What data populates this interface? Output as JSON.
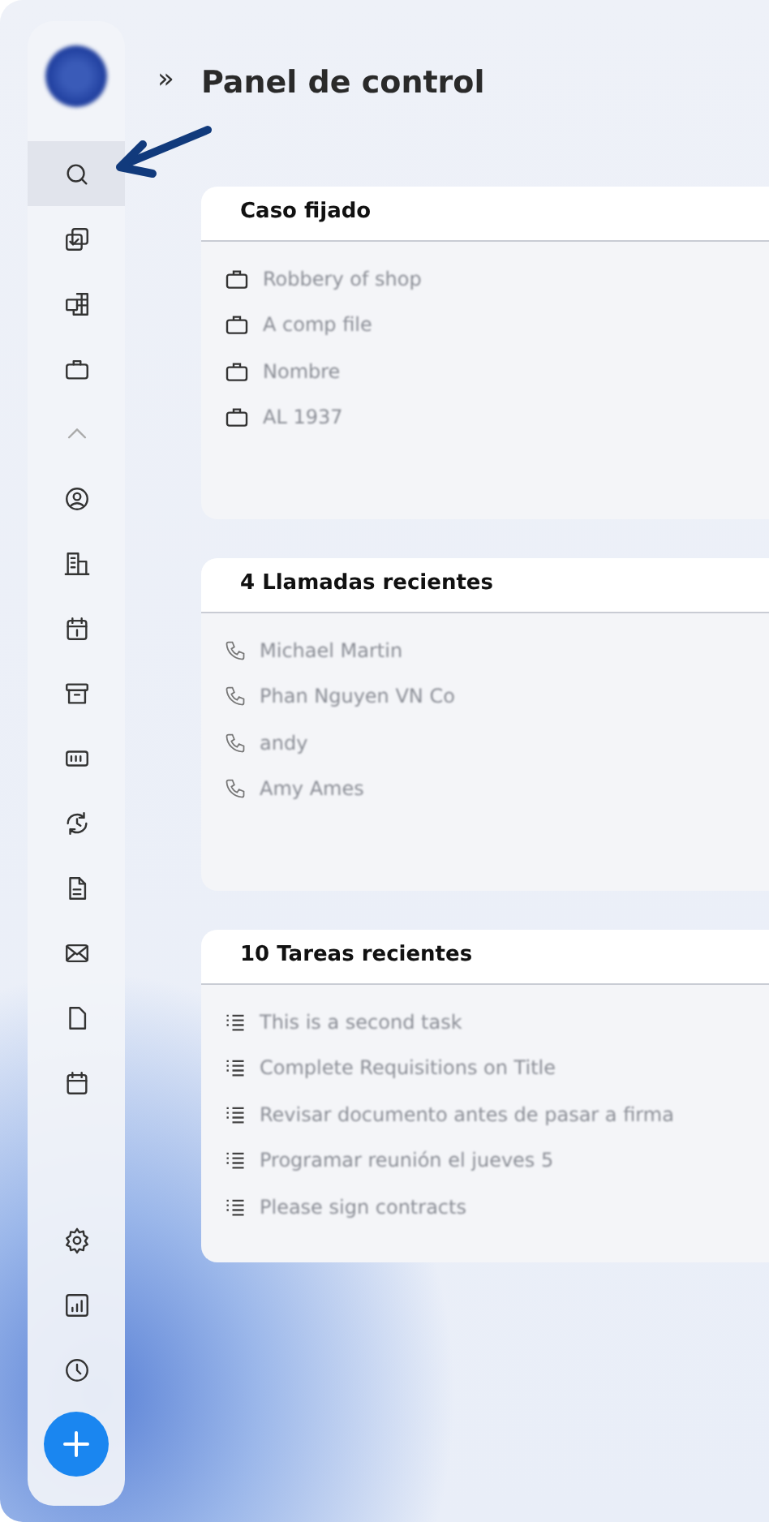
{
  "sidebar": {
    "items": [
      {
        "selected": true
      },
      {
        "selected": false
      },
      {
        "selected": false
      },
      {
        "selected": false
      },
      {
        "selected": false
      },
      {
        "selected": false
      },
      {
        "selected": false
      },
      {
        "selected": false
      },
      {
        "selected": false
      },
      {
        "selected": false
      },
      {
        "selected": false
      },
      {
        "selected": false
      },
      {
        "selected": false
      },
      {
        "selected": false
      },
      {
        "selected": false
      }
    ]
  },
  "expand_toggle": "»",
  "title": "Panel de control",
  "panels": [
    {
      "kind": "case",
      "title": "Caso fijado",
      "items": [
        "Robbery of shop",
        "A comp file",
        "Nombre",
        "AL 1937"
      ]
    },
    {
      "kind": "call",
      "title": "4 Llamadas recientes",
      "items": [
        "Michael Martin",
        "Phan Nguyen VN Co",
        "andy",
        "Amy Ames"
      ]
    },
    {
      "kind": "task",
      "title": "10 Tareas recientes",
      "items": [
        "This is a second task",
        "Complete Requisitions on Title",
        "Revisar documento antes de pasar a firma",
        "Programar reunión el jueves 5",
        "Please sign contracts"
      ]
    }
  ]
}
